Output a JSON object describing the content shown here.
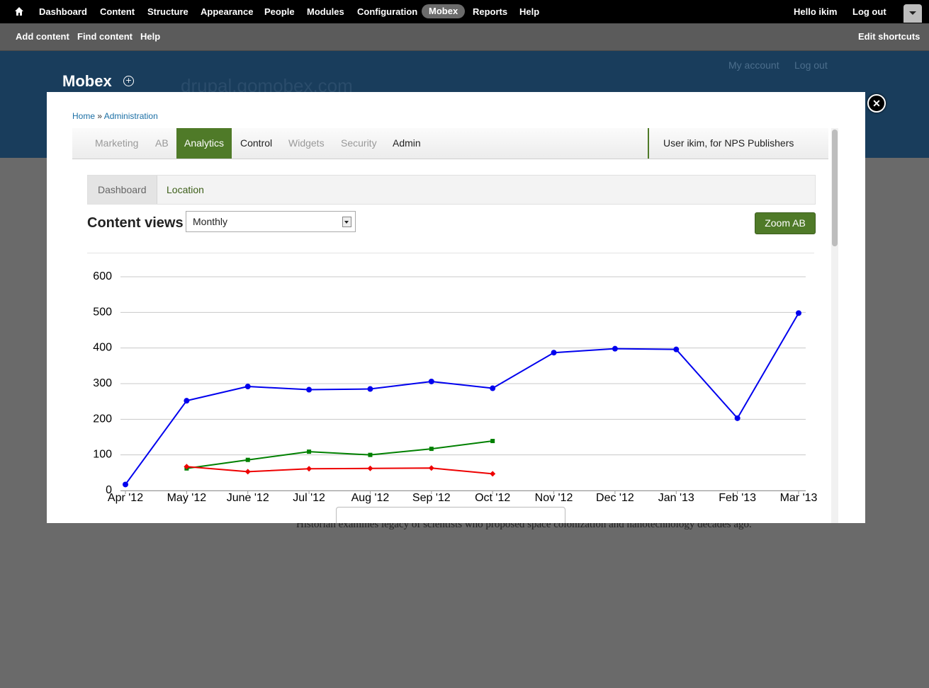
{
  "admin_toolbar": {
    "items": [
      {
        "label": "Dashboard"
      },
      {
        "label": "Content"
      },
      {
        "label": "Structure"
      },
      {
        "label": "Appearance"
      },
      {
        "label": "People"
      },
      {
        "label": "Modules"
      },
      {
        "label": "Configuration"
      },
      {
        "label": "Mobex",
        "active": true
      },
      {
        "label": "Reports"
      },
      {
        "label": "Help"
      }
    ],
    "greeting_prefix": "Hello",
    "username": "ikim",
    "logout_label": "Log out"
  },
  "shortcuts": {
    "items": [
      {
        "label": "Add content"
      },
      {
        "label": "Find content"
      },
      {
        "label": "Help"
      }
    ],
    "edit_label": "Edit shortcuts"
  },
  "site_header": {
    "logo_text": "Mobex",
    "site_name": "drupal.gomobex.com",
    "my_account": "My account",
    "log_out": "Log out"
  },
  "background_text": "Historian examines legacy of scientists who proposed space colonization and nanotechnology decades ago.",
  "overlay": {
    "breadcrumb": {
      "home": "Home",
      "sep": "»",
      "admin": "Administration"
    },
    "tabs": [
      {
        "label": "Marketing"
      },
      {
        "label": "AB"
      },
      {
        "label": "Analytics",
        "active": true
      },
      {
        "label": "Control"
      },
      {
        "label": "Widgets"
      },
      {
        "label": "Security"
      },
      {
        "label": "Admin"
      }
    ],
    "user_info": "User ikim, for NPS Publishers",
    "subtabs": [
      {
        "label": "Dashboard",
        "active": true
      },
      {
        "label": "Location"
      }
    ],
    "content_views_title": "Content views",
    "period_select": {
      "selected": "Monthly"
    },
    "zoom_button": "Zoom AB"
  },
  "chart_data": {
    "type": "line",
    "title": "",
    "xlabel": "",
    "ylabel": "",
    "categories": [
      "Apr '12",
      "May '12",
      "June '12",
      "Jul '12",
      "Aug '12",
      "Sep '12",
      "Oct '12",
      "Nov '12",
      "Dec '12",
      "Jan '13",
      "Feb '13",
      "Mar '13"
    ],
    "ylim": [
      0,
      600
    ],
    "yticks": [
      0,
      100,
      200,
      300,
      400,
      500,
      600
    ],
    "grid": true,
    "series": [
      {
        "color": "#0000ee",
        "marker": "circle",
        "values": [
          17,
          252,
          292,
          283,
          285,
          306,
          287,
          387,
          398,
          396,
          203,
          498
        ]
      },
      {
        "color": "#008000",
        "marker": "square",
        "values": [
          null,
          62,
          86,
          109,
          100,
          117,
          139,
          null,
          null,
          null,
          null,
          null
        ]
      },
      {
        "color": "#ee0000",
        "marker": "diamond",
        "values": [
          null,
          67,
          53,
          61,
          62,
          63,
          47,
          null,
          null,
          null,
          null,
          null
        ]
      }
    ]
  }
}
